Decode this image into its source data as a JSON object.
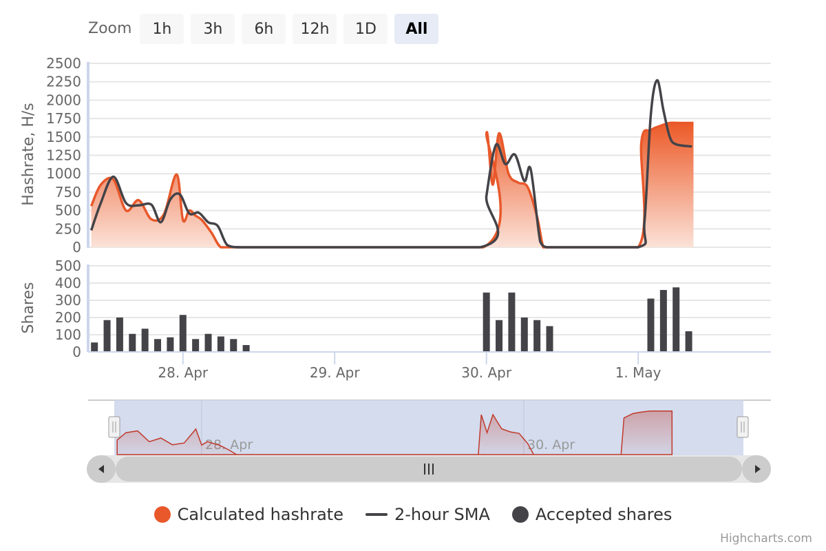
{
  "zoom": {
    "label": "Zoom",
    "buttons": [
      "1h",
      "3h",
      "6h",
      "12h",
      "1D",
      "All"
    ],
    "active": "All"
  },
  "colors": {
    "hashrate": "#e8582a",
    "hashrate_fill_top": "#ec5a28",
    "hashrate_fill_bottom": "#fbe2d8",
    "sma": "#434348",
    "shares": "#434348",
    "grid": "#e6e6e6",
    "navigator_mask": "#cfd8ec",
    "navigator_series": "#c0392b",
    "scrollbar": "#cccccc"
  },
  "legend": {
    "hashrate": "Calculated hashrate",
    "sma": "2-hour SMA",
    "shares": "Accepted shares"
  },
  "credits": "Highcharts.com",
  "chart_data": [
    {
      "type": "area",
      "ylabel": "Hashrate, H/s",
      "ylim": [
        0,
        2500
      ],
      "yticks": [
        0,
        250,
        500,
        750,
        1000,
        1250,
        1500,
        1750,
        2000,
        2250,
        2500
      ],
      "xlim": [
        "27 Apr 09:00",
        "1 May 21:00"
      ],
      "xticks": [
        "28. Apr",
        "29. Apr",
        "30. Apr",
        "1. May"
      ],
      "grid": true,
      "series": [
        {
          "name": "Calculated hashrate",
          "x": [
            "27 Apr 09:30",
            "27 Apr 11:00",
            "27 Apr 13:00",
            "27 Apr 15:00",
            "27 Apr 17:00",
            "27 Apr 19:00",
            "27 Apr 21:00",
            "27 Apr 23:00",
            "28 Apr 00:00",
            "28 Apr 01:00",
            "28 Apr 02:00",
            "28 Apr 03:00",
            "28 Apr 04:30",
            "28 Apr 06:00",
            "28 Apr 08:00",
            "28 Apr 10:00",
            "28 Apr 11:30",
            "28 Apr 12:00",
            "29 Apr 23:30",
            "29 Apr 24:00",
            "30 Apr 01:00",
            "30 Apr 02:00",
            "30 Apr 03:30",
            "30 Apr 05:00",
            "30 Apr 06:30",
            "30 Apr 08:00",
            "30 Apr 09:00",
            "30 Apr 10:00",
            "30 Apr 11:00",
            "30 Apr 12:00",
            "1 May 00:00",
            "1 May 00:30",
            "1 May 02:00",
            "1 May 03:30",
            "1 May 05:00",
            "1 May 06:30",
            "1 May 07:30",
            "1 May 08:00",
            "1 May 08:45"
          ],
          "values": [
            560,
            850,
            920,
            500,
            640,
            380,
            450,
            990,
            370,
            500,
            430,
            370,
            200,
            0,
            0,
            0,
            0,
            0,
            0,
            1550,
            850,
            1550,
            1000,
            880,
            820,
            420,
            0,
            0,
            0,
            0,
            0,
            1420,
            1590,
            1650,
            1690,
            1690,
            1690,
            1690,
            1690
          ]
        },
        {
          "name": "2-hour SMA",
          "x": [
            "27 Apr 09:30",
            "27 Apr 11:00",
            "27 Apr 13:00",
            "27 Apr 15:00",
            "27 Apr 17:00",
            "27 Apr 19:00",
            "27 Apr 20:30",
            "27 Apr 22:00",
            "27 Apr 23:30",
            "28 Apr 01:00",
            "28 Apr 02:30",
            "28 Apr 04:00",
            "28 Apr 05:30",
            "28 Apr 07:00",
            "28 Apr 09:00",
            "28 Apr 12:00",
            "29 Apr 23:00",
            "30 Apr 00:00",
            "30 Apr 01:30",
            "30 Apr 03:00",
            "30 Apr 04:30",
            "30 Apr 06:00",
            "30 Apr 07:00",
            "30 Apr 08:30",
            "30 Apr 09:30",
            "30 Apr 10:30",
            "30 Apr 12:00",
            "1 May 00:00",
            "1 May 01:00",
            "1 May 02:00",
            "1 May 03:00",
            "1 May 04:00",
            "1 May 05:00",
            "1 May 06:00",
            "1 May 08:30"
          ],
          "values": [
            230,
            600,
            960,
            600,
            570,
            580,
            340,
            650,
            720,
            460,
            470,
            340,
            290,
            30,
            0,
            0,
            0,
            700,
            1390,
            1130,
            1260,
            900,
            1060,
            80,
            0,
            0,
            0,
            0,
            350,
            1800,
            2270,
            1860,
            1500,
            1400,
            1370
          ]
        }
      ]
    },
    {
      "type": "bar",
      "ylabel": "Shares",
      "ylim": [
        0,
        500
      ],
      "yticks": [
        0,
        100,
        200,
        300,
        400,
        500
      ],
      "grid": true,
      "series": [
        {
          "name": "Accepted shares",
          "x": [
            "27 Apr 10:00",
            "27 Apr 12:00",
            "27 Apr 14:00",
            "27 Apr 16:00",
            "27 Apr 18:00",
            "27 Apr 20:00",
            "27 Apr 22:00",
            "28 Apr 00:00",
            "28 Apr 02:00",
            "28 Apr 04:00",
            "28 Apr 06:00",
            "28 Apr 08:00",
            "28 Apr 10:00",
            "30 Apr 00:00",
            "30 Apr 02:00",
            "30 Apr 04:00",
            "30 Apr 06:00",
            "30 Apr 08:00",
            "30 Apr 10:00",
            "1 May 02:00",
            "1 May 04:00",
            "1 May 06:00",
            "1 May 08:00"
          ],
          "values": [
            55,
            185,
            200,
            105,
            135,
            75,
            85,
            215,
            75,
            105,
            90,
            75,
            40,
            345,
            185,
            345,
            200,
            185,
            150,
            310,
            360,
            375,
            120
          ]
        }
      ]
    }
  ],
  "navigator": {
    "labels": [
      "28. Apr",
      "30. Apr"
    ]
  }
}
